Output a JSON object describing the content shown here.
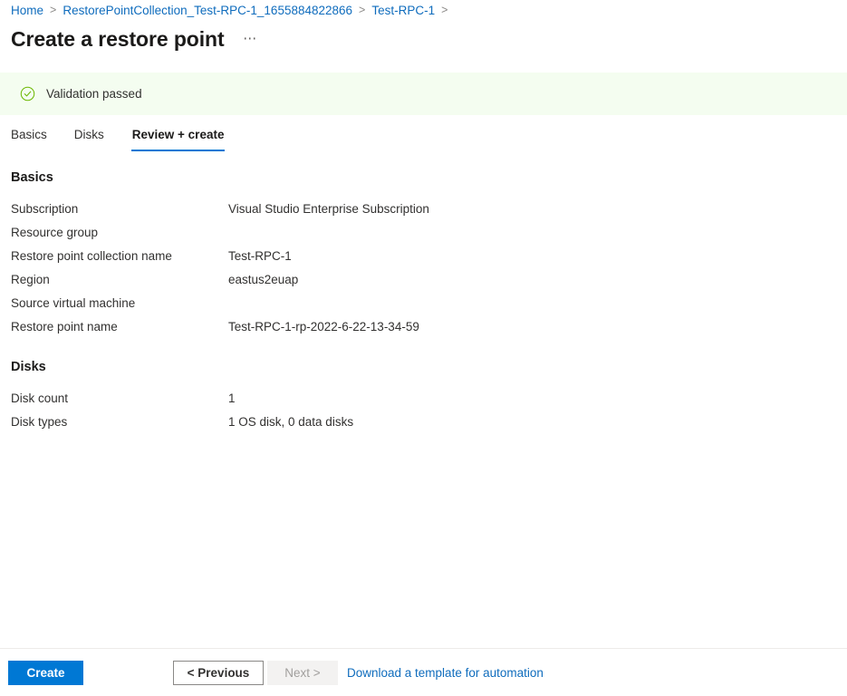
{
  "breadcrumb": {
    "items": [
      {
        "label": "Home",
        "link": true
      },
      {
        "label": "RestorePointCollection_Test-RPC-1_1655884822866",
        "link": true
      },
      {
        "label": "Test-RPC-1",
        "link": true
      }
    ],
    "separator": ">"
  },
  "header": {
    "title": "Create a restore point",
    "more_label": "⋯"
  },
  "validation": {
    "message": "Validation passed",
    "icon": "check-circle-icon",
    "background_color": "#f4fdf0",
    "accent_color": "#6bb700"
  },
  "tabs": [
    {
      "label": "Basics",
      "active": false
    },
    {
      "label": "Disks",
      "active": false
    },
    {
      "label": "Review + create",
      "active": true
    }
  ],
  "sections": [
    {
      "heading": "Basics",
      "rows": [
        {
          "label": "Subscription",
          "value": "Visual Studio Enterprise Subscription"
        },
        {
          "label": "Resource group",
          "value": ""
        },
        {
          "label": "Restore point collection name",
          "value": "Test-RPC-1"
        },
        {
          "label": "Region",
          "value": "eastus2euap"
        },
        {
          "label": "Source virtual machine",
          "value": ""
        },
        {
          "label": "Restore point name",
          "value": "Test-RPC-1-rp-2022-6-22-13-34-59"
        }
      ]
    },
    {
      "heading": "Disks",
      "rows": [
        {
          "label": "Disk count",
          "value": "1"
        },
        {
          "label": "Disk types",
          "value": "1 OS disk, 0 data disks"
        }
      ]
    }
  ],
  "footer": {
    "create_label": "Create",
    "previous_label": "< Previous",
    "next_label": "Next >",
    "template_link_label": "Download a template for automation"
  },
  "colors": {
    "accent": "#0078d4",
    "link": "#0f6cbd",
    "success": "#6bb700",
    "text": "#323130",
    "disabled_text": "#a19f9d"
  }
}
